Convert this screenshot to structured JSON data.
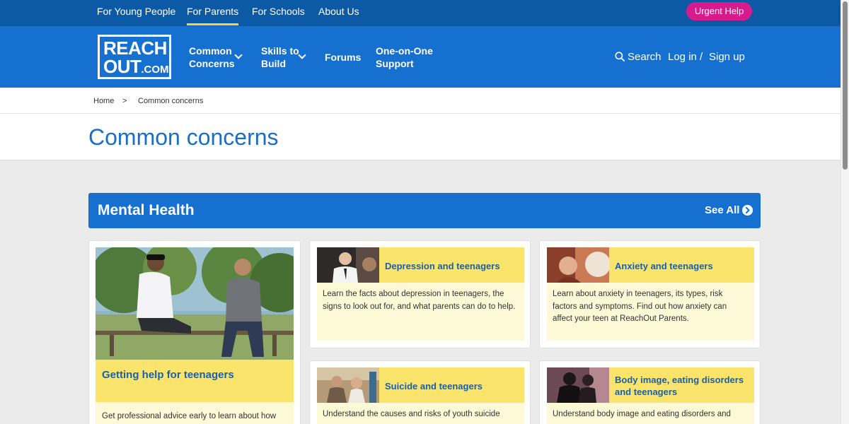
{
  "topbar": {
    "links": [
      "For Young People",
      "For Parents",
      "For Schools",
      "About Us"
    ],
    "active": "For Parents",
    "urgent_label": "Urgent Help"
  },
  "mainnav": {
    "logo_line1": "REACH",
    "logo_line2": "OUT",
    "logo_suffix": ".COM",
    "items": [
      {
        "line1": "Common",
        "line2": "Concerns"
      },
      {
        "line1": "Skills to",
        "line2": "Build"
      },
      {
        "line1": "Forums",
        "line2": ""
      },
      {
        "line1": "One-on-One",
        "line2": "Support"
      }
    ],
    "search_label": "Search",
    "login_label": "Log in",
    "separator": "/",
    "signup_label": "Sign up"
  },
  "breadcrumb": {
    "home": "Home",
    "separator": ">",
    "current": "Common concerns"
  },
  "page": {
    "title": "Common concerns"
  },
  "section": {
    "title": "Mental Health",
    "see_all": "See All"
  },
  "cards": {
    "featured": {
      "title": "Getting help for teenagers",
      "desc": "Get professional advice early to learn about how"
    },
    "depression": {
      "title": "Depression and teenagers",
      "desc": "Learn the facts about depression in teenagers, the signs to look out for, and what parents can do to help."
    },
    "anxiety": {
      "title": "Anxiety and teenagers",
      "desc": "Learn about anxiety in teenagers, its types, risk factors and symptoms. Find out how anxiety can affect your teen at ReachOut Parents."
    },
    "suicide": {
      "title": "Suicide and teenagers",
      "desc": "Understand the causes and risks of youth suicide"
    },
    "bodyimage": {
      "title": "Body image, eating disorders and teenagers",
      "desc": "Understand body image and eating disorders and"
    }
  },
  "colors": {
    "topbar": "#0c5aa6",
    "nav": "#1570cf",
    "accent_yellow": "#fbe46c",
    "urgent_pink": "#d81b8c",
    "title_blue": "#1a6fc4"
  }
}
